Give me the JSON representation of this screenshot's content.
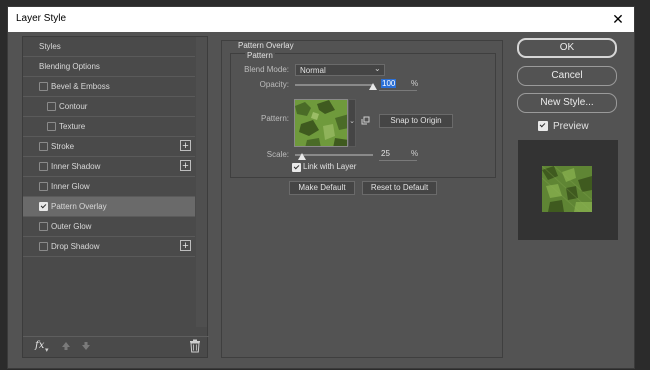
{
  "window": {
    "title": "Layer Style",
    "close_glyph": "✕"
  },
  "sidebar": {
    "items": [
      {
        "label": "Styles",
        "checkbox": false,
        "checked": false,
        "indent": false,
        "plus": false,
        "selected": false
      },
      {
        "label": "Blending Options",
        "checkbox": false,
        "checked": false,
        "indent": false,
        "plus": false,
        "selected": false
      },
      {
        "label": "Bevel & Emboss",
        "checkbox": true,
        "checked": false,
        "indent": false,
        "plus": false,
        "selected": false
      },
      {
        "label": "Contour",
        "checkbox": true,
        "checked": false,
        "indent": true,
        "plus": false,
        "selected": false
      },
      {
        "label": "Texture",
        "checkbox": true,
        "checked": false,
        "indent": true,
        "plus": false,
        "selected": false
      },
      {
        "label": "Stroke",
        "checkbox": true,
        "checked": false,
        "indent": false,
        "plus": true,
        "selected": false
      },
      {
        "label": "Inner Shadow",
        "checkbox": true,
        "checked": false,
        "indent": false,
        "plus": true,
        "selected": false
      },
      {
        "label": "Inner Glow",
        "checkbox": true,
        "checked": false,
        "indent": false,
        "plus": false,
        "selected": false
      },
      {
        "label": "Pattern Overlay",
        "checkbox": true,
        "checked": true,
        "indent": false,
        "plus": false,
        "selected": true
      },
      {
        "label": "Outer Glow",
        "checkbox": true,
        "checked": false,
        "indent": false,
        "plus": false,
        "selected": false
      },
      {
        "label": "Drop Shadow",
        "checkbox": true,
        "checked": false,
        "indent": false,
        "plus": true,
        "selected": false
      }
    ],
    "plus_glyph": "+",
    "footer": {
      "fx_label": "fx",
      "fx_dot": "▾",
      "up_icon": "move-up-icon",
      "down_icon": "move-down-icon",
      "trash_icon": "trash-icon"
    }
  },
  "main": {
    "group_title": "Pattern Overlay",
    "sub_title": "Pattern",
    "blend_mode_label": "Blend Mode:",
    "blend_mode_value": "Normal",
    "opacity_label": "Opacity:",
    "opacity_value": "100",
    "opacity_fraction": 1.0,
    "pattern_label": "Pattern:",
    "snap_button": "Snap to Origin",
    "scale_label": "Scale:",
    "scale_value": "25",
    "scale_fraction": 0.09,
    "percent": "%",
    "link_label": "Link with Layer",
    "link_checked": true,
    "make_default": "Make Default",
    "reset_default": "Reset to Default"
  },
  "right": {
    "ok": "OK",
    "cancel": "Cancel",
    "new_style": "New Style...",
    "preview_label": "Preview",
    "preview_checked": true
  },
  "colors": {
    "dialog_bg": "#535353",
    "selected_row": "#6a6a6a",
    "highlight": "#2a6fd6",
    "camo_light": "#6f9a3c",
    "camo_dark": "#3f5a1f"
  }
}
